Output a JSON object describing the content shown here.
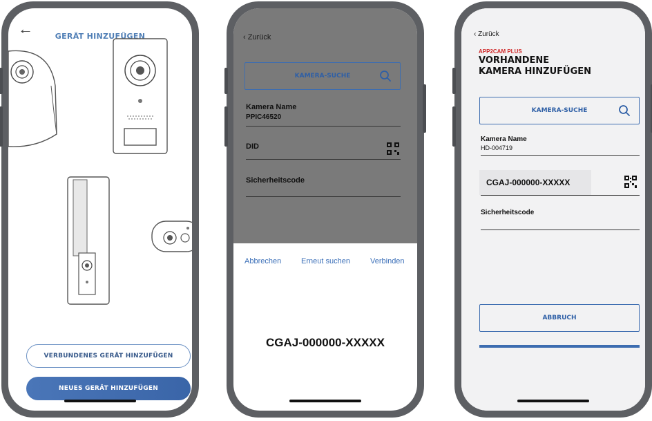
{
  "phone1": {
    "back_glyph": "←",
    "title": "GERÄT HINZUFÜGEN",
    "button_connected": "VERBUNDENES GERÄT HINZUFÜGEN",
    "button_new": "NEUES GERÄT HINZUFÜGEN"
  },
  "phone2": {
    "back": "‹ Zurück",
    "search_label": "KAMERA-SUCHE",
    "camera_name_label": "Kamera Name",
    "camera_name_value": "PPIC46520",
    "did_label": "DID",
    "security_label": "Sicherheitscode",
    "actions": {
      "cancel": "Abbrechen",
      "search_again": "Erneut suchen",
      "connect": "Verbinden"
    },
    "big_code": "CGAJ-000000-XXXXX"
  },
  "phone3": {
    "back": "‹ Zurück",
    "brand": "APP2CAM PLUS",
    "title_line1": "VORHANDENE",
    "title_line2": "KAMERA HINZUFÜGEN",
    "search_label": "KAMERA-SUCHE",
    "camera_name_label": "Kamera Name",
    "camera_name_value": "HD-004719",
    "did_value": "CGAJ-000000-XXXXX",
    "security_label": "Sicherheitscode",
    "abort_label": "ABBRUCH"
  },
  "colors": {
    "accent": "#3d6db0",
    "brand_red": "#d02a2a",
    "frame": "#5d5f63",
    "overlay": "#7a7a7a"
  },
  "icons": [
    "arrow-left-icon",
    "search-icon",
    "qr-code-icon",
    "chevron-left-icon"
  ]
}
